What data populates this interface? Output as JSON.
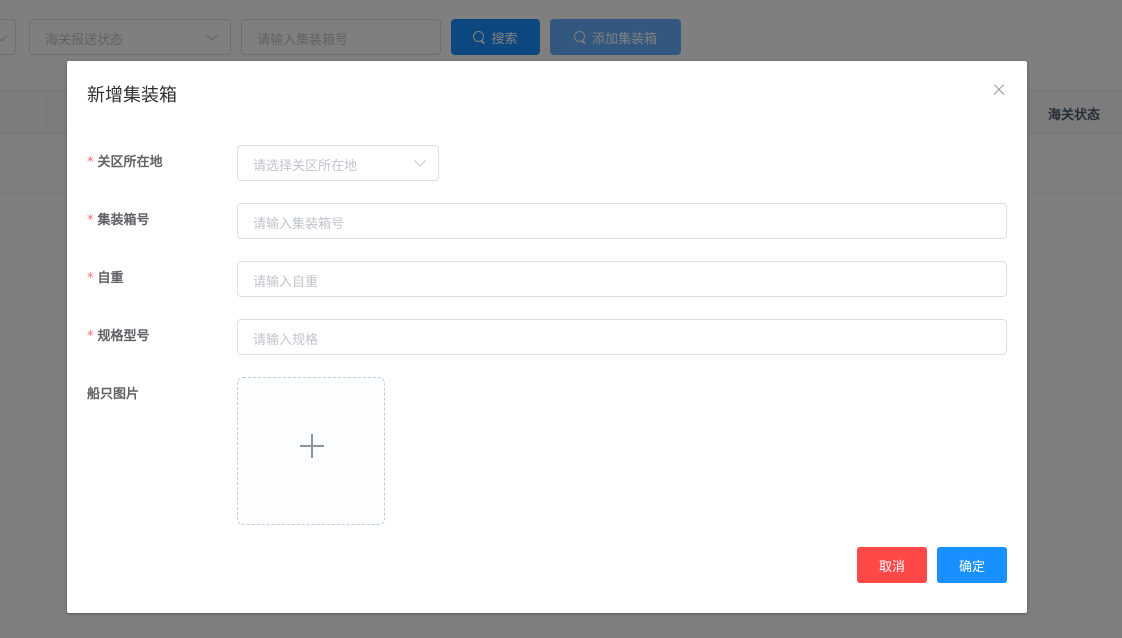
{
  "background": {
    "filters": {
      "customs_status_placeholder": "海关报送状态",
      "container_no_placeholder": "请输入集装箱号"
    },
    "buttons": {
      "search_label": "搜索",
      "add_label": "添加集装箱"
    },
    "table": {
      "last_column_header": "海关状态"
    }
  },
  "dialog": {
    "title": "新增集装箱",
    "fields": {
      "location": {
        "label": "关区所在地",
        "required": true,
        "placeholder": "请选择关区所在地"
      },
      "container_no": {
        "label": "集装箱号",
        "required": true,
        "placeholder": "请输入集装箱号"
      },
      "tare_weight": {
        "label": "自重",
        "required": true,
        "placeholder": "请输入自重"
      },
      "spec": {
        "label": "规格型号",
        "required": true,
        "placeholder": "请输入规格"
      },
      "ship_image": {
        "label": "船只图片",
        "required": false
      }
    },
    "required_mark": "*",
    "buttons": {
      "cancel_label": "取消",
      "confirm_label": "确定"
    }
  },
  "colors": {
    "primary": "#1890ff",
    "danger": "#ff4949",
    "required": "#f56c6c",
    "overlay": "rgba(0,0,0,0.5)"
  },
  "icons": [
    "chevron-down-icon",
    "search-icon",
    "close-icon",
    "plus-icon"
  ]
}
